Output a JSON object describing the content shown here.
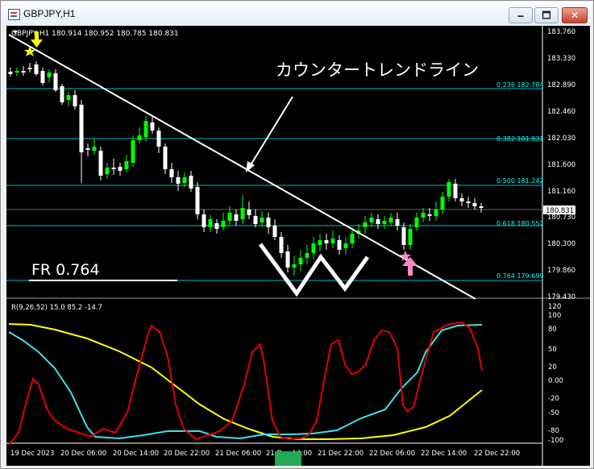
{
  "window": {
    "title": "GBPJPY,H1",
    "buttons": {
      "minimize": "🗕",
      "maximize": "🗖",
      "close": "✕"
    }
  },
  "chart": {
    "header": "GBPJPY,H1  180.914 180.952 180.785 180.831",
    "price_labels": [
      "183.760",
      "183.330",
      "182.890",
      "182.460",
      "182.030",
      "181.600",
      "181.160",
      "180.730",
      "180.300",
      "179.860",
      "179.430"
    ],
    "current_price": "180.831",
    "fib_labels": [
      {
        "text": "0.236  182.784"
      },
      {
        "text": "0.382  181.931"
      },
      {
        "text": "0.500  181.242"
      },
      {
        "text": "0.618  180.552"
      },
      {
        "text": "0.764  179.699"
      }
    ],
    "trendline_label": "カウンタートレンドライン",
    "fr_label": "FR 0.764",
    "indicator_header": "R(9,26,52) 15.0 85.2 -14.7",
    "indicator_scale": [
      "120",
      "100",
      "80",
      "50",
      "20",
      "0.00",
      "-20",
      "-50",
      "-80",
      "-100"
    ],
    "time_labels": [
      "19 Dec 2023",
      "20 Dec 06:00",
      "20 Dec 14:00",
      "20 Dec 22:00",
      "21 Dec 06:00",
      "21 Dec 14:00",
      "21 Dec 22:00",
      "22 Dec 06:00",
      "22 Dec 14:00",
      "22 Dec 22:00"
    ]
  },
  "colors": {
    "background": "#000000",
    "bull": "#00ff00",
    "bear": "#ffffff",
    "fib": "#00ffff",
    "trendline": "#ffffff",
    "star": "#ffff00",
    "arrow_down": "#ffff00",
    "arrow_up": "#ff88c8",
    "rsi_red": "#e00000",
    "rsi_cyan": "#40e0e8",
    "rsi_yellow": "#ffff00",
    "marker_green": "#22aa55"
  }
}
